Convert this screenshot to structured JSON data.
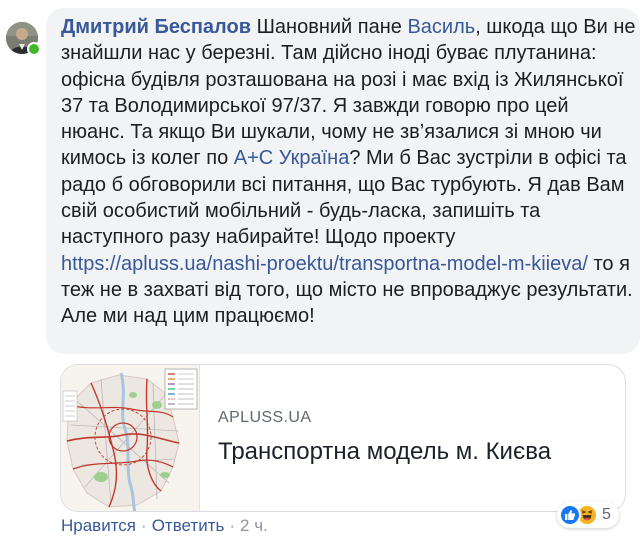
{
  "comment": {
    "author": "Дмитрий Беспалов",
    "text_1": " Шановний пане ",
    "mention_1": "Василь",
    "text_2": ", шкода що Ви не знайшли нас у березні. Там дійсно іноді буває плутанина: офісна будівля розташована на розі і має вхід із Жилянської 37 та Володимирської 97/37. Я завжди говорю про цей нюанс. Та якщо Ви шукали, чому не зв’язалися зі мною чи кимось із колег по ",
    "mention_2": "A+C Україна",
    "text_3": "? Ми б Вас зустріли в офісі та радо б обговорили всі питання, що Вас турбують. Я дав Вам свій особистий мобільний - будь-ласка, запишіть та наступного разу набирайте! Щодо проекту ",
    "url": "https://apluss.ua/nashi-proektu/transportna-model-m-kiieva/",
    "text_4": " то я теж не в захваті від того, що місто не впроваджує результати. Але ми над цим працюємо!"
  },
  "link_preview": {
    "domain": "APLUSS.UA",
    "title": "Транспортна модель м. Києва"
  },
  "actions": {
    "like": "Нравится",
    "reply": "Ответить",
    "time": "2 ч."
  },
  "reactions": {
    "count": "5",
    "types": [
      "like-icon",
      "haha-icon"
    ]
  },
  "colors": {
    "link": "#385898",
    "bubble": "#f2f3f5",
    "online": "#42b72a",
    "like": "#1877f2",
    "haha": "#f7b125"
  }
}
